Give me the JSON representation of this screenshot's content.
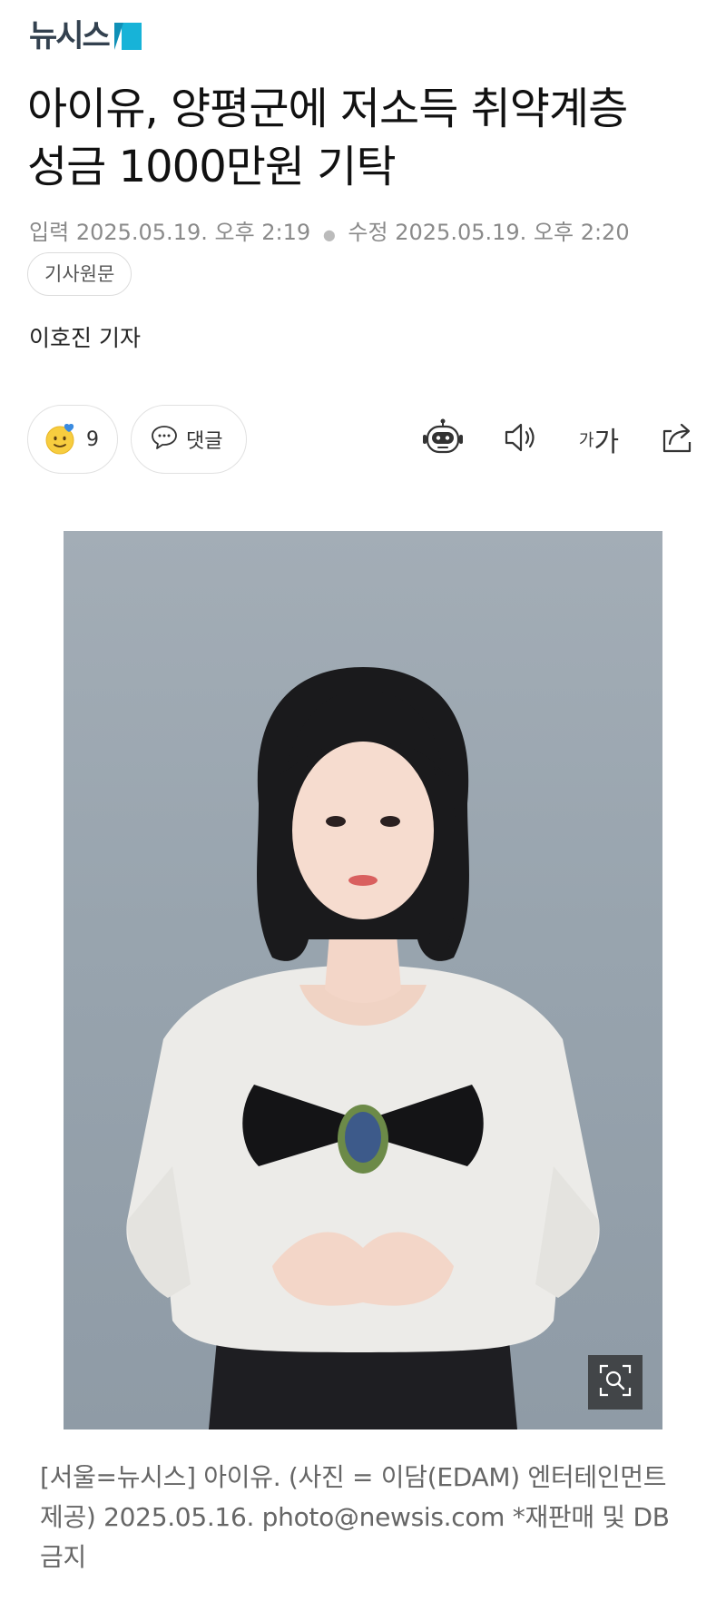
{
  "header": {
    "logo_text": "뉴시스",
    "brand_colors": {
      "logo_text": "#33414f",
      "logo_mark_light": "#17b3d8",
      "logo_mark_dark": "#0f90b7"
    }
  },
  "article": {
    "headline_line1": "아이유, 양평군에 저소득 취약계층",
    "headline_line2": "성금 1000만원 기탁",
    "published_label": "입력",
    "published_time": "2025.05.19. 오후 2:19",
    "updated_label": "수정",
    "updated_time": "2025.05.19. 오후 2:20",
    "original_link_label": "기사원문",
    "reporter": "이호진 기자"
  },
  "actions": {
    "reaction_icon": "smiley-heart-icon",
    "reaction_count": "9",
    "comment_icon": "speech-bubble-icon",
    "comment_label": "댓글",
    "summary_bot_icon": "robot-icon",
    "read_aloud_icon": "speaker-icon",
    "font_size_small": "가",
    "font_size_large": "가",
    "share_icon": "share-icon"
  },
  "photo": {
    "alt": "아이유",
    "zoom_icon": "zoom-icon",
    "caption": "[서울=뉴시스] 아이유. (사진 = 이담(EDAM) 엔터테인먼트 제공) 2025.05.16. photo@newsis.com *재판매 및 DB 금지"
  }
}
